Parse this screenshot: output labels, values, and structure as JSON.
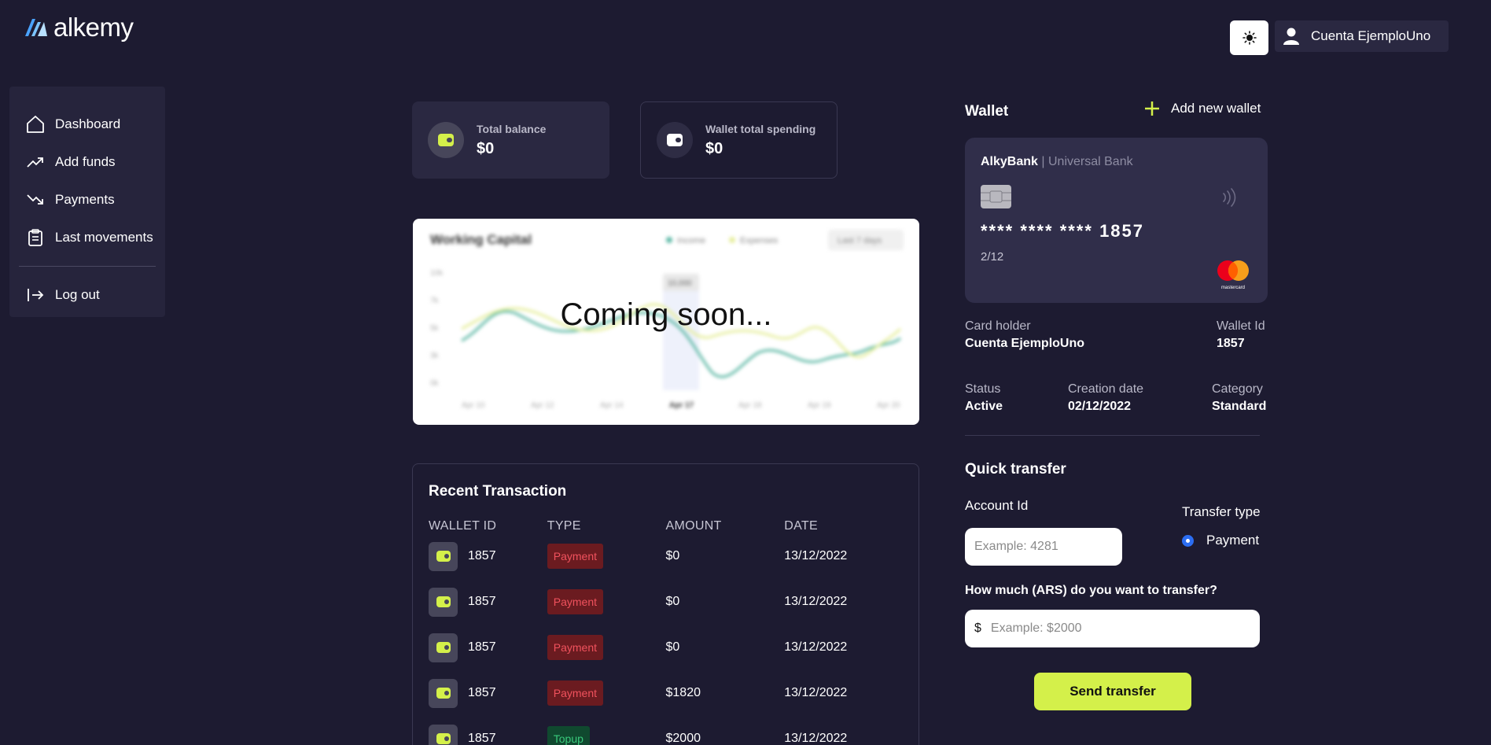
{
  "app": {
    "logo_text": "alkemy",
    "brand_accent": "#d4f04a",
    "link_accent": "#2c6ef2"
  },
  "header": {
    "theme_toggle_icon": "sun-icon",
    "account_icon": "user-icon",
    "account_name": "Cuenta EjemploUno"
  },
  "sidebar": {
    "items": [
      {
        "label": "Dashboard",
        "icon": "home-icon"
      },
      {
        "label": "Add funds",
        "icon": "trend-up-icon"
      },
      {
        "label": "Payments",
        "icon": "trend-down-icon"
      },
      {
        "label": "Last movements",
        "icon": "clipboard-icon"
      }
    ],
    "logout": {
      "label": "Log out",
      "icon": "logout-icon"
    }
  },
  "stats": {
    "total_balance": {
      "label": "Total balance",
      "value": "$0",
      "icon": "wallet-icon"
    },
    "wallet_spending": {
      "label": "Wallet total spending",
      "value": "$0",
      "icon": "wallet-icon"
    }
  },
  "chart_preview": {
    "overlay_text": "Coming soon...",
    "title": "Working Capital",
    "legend": [
      "Income",
      "Expenses"
    ],
    "range_select": "Last 7 days",
    "y_ticks": [
      "10k",
      "7k",
      "5k",
      "3k",
      "0k"
    ],
    "x_ticks": [
      "Apr 10",
      "Apr 12",
      "Apr 14",
      "Apr 17",
      "Apr 18",
      "Apr 19",
      "Apr 20"
    ],
    "tooltip": "10,000",
    "income_color": "#5db8a5",
    "expenses_color": "#e6ee9c"
  },
  "transactions": {
    "title": "Recent Transaction",
    "columns": [
      "WALLET ID",
      "TYPE",
      "AMOUNT",
      "DATE"
    ],
    "rows": [
      {
        "wallet_id": "1857",
        "type": "Payment",
        "amount": "$0",
        "date": "13/12/2022"
      },
      {
        "wallet_id": "1857",
        "type": "Payment",
        "amount": "$0",
        "date": "13/12/2022"
      },
      {
        "wallet_id": "1857",
        "type": "Payment",
        "amount": "$0",
        "date": "13/12/2022"
      },
      {
        "wallet_id": "1857",
        "type": "Payment",
        "amount": "$1820",
        "date": "13/12/2022"
      },
      {
        "wallet_id": "1857",
        "type": "Topup",
        "amount": "$2000",
        "date": "13/12/2022"
      }
    ]
  },
  "wallet": {
    "title": "Wallet",
    "add_label": "Add new wallet",
    "card": {
      "bank": "AlkyBank",
      "separator": "|",
      "bank_sub": "Universal Bank",
      "number": "**** **** **** 1857",
      "expiry": "2/12",
      "network": "mastercard"
    },
    "card_holder_label": "Card holder",
    "card_holder": "Cuenta EjemploUno",
    "wallet_id_label": "Wallet Id",
    "wallet_id": "1857",
    "status_label": "Status",
    "status": "Active",
    "creation_label": "Creation date",
    "creation_date": "02/12/2022",
    "category_label": "Category",
    "category": "Standard"
  },
  "quick_transfer": {
    "title": "Quick transfer",
    "account_label": "Account Id",
    "account_placeholder": "Example: 4281",
    "transfer_type_label": "Transfer type",
    "transfer_type_option": "Payment",
    "amount_label": "How much (ARS) do you want to transfer?",
    "amount_prefix": "$",
    "amount_placeholder": "Example: $2000",
    "send_label": "Send transfer"
  }
}
